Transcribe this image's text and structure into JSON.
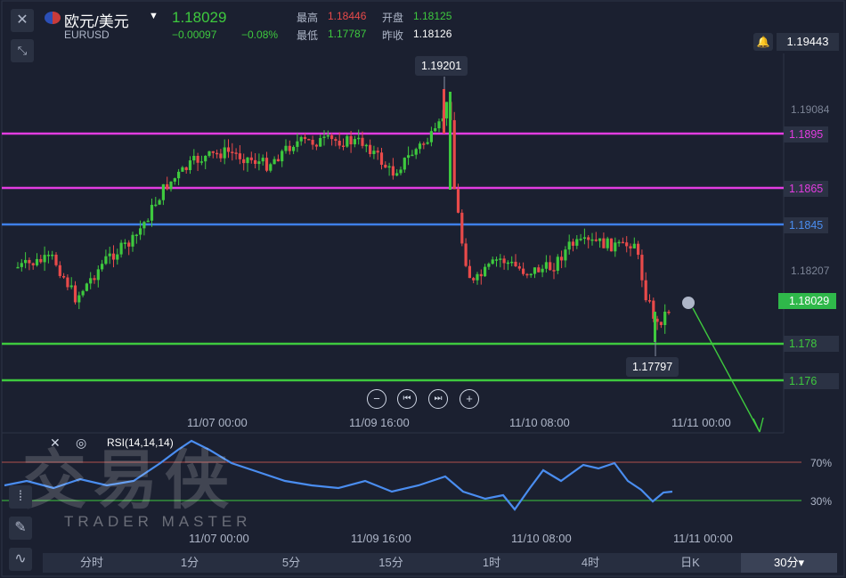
{
  "header": {
    "symbol": "欧元/美元",
    "symbol_code": "EURUSD",
    "price": "1.18029",
    "change": "−0.00097",
    "change_pct": "−0.08%",
    "high_label": "最高",
    "high": "1.18446",
    "open_label": "开盘",
    "open": "1.18125",
    "low_label": "最低",
    "low": "1.17787",
    "prev_label": "昨收",
    "prev": "1.18126",
    "alert_price": "1.19443"
  },
  "price_axis": {
    "labels": [
      "1.19084",
      "1.18207"
    ],
    "current": "1.18029"
  },
  "lines": [
    {
      "label": "1.1895",
      "color": "#e23ce0"
    },
    {
      "label": "1.1865",
      "color": "#e23ce0"
    },
    {
      "label": "1.1845",
      "color": "#3f7fe8"
    },
    {
      "label": "1.178",
      "color": "#3ec93e"
    },
    {
      "label": "1.176",
      "color": "#3ec93e"
    }
  ],
  "tooltips": {
    "high": "1.19201",
    "low": "1.17797"
  },
  "time_axis": [
    "11/07 00:00",
    "11/09 16:00",
    "11/10 08:00",
    "11/11 00:00"
  ],
  "rsi": {
    "label": "RSI(14,14,14)",
    "levels": [
      "70%",
      "30%"
    ],
    "time_axis": [
      "11/07 00:00",
      "11/09 16:00",
      "11/10 08:00",
      "11/11 00:00"
    ]
  },
  "watermark": {
    "cn": "交易侠",
    "en": "TRADER MASTER"
  },
  "timeframes": [
    "分时",
    "1分",
    "5分",
    "15分",
    "1时",
    "4时",
    "日K",
    "30分▾"
  ],
  "colors": {
    "up": "#3ec93e",
    "down": "#e84a4a",
    "rsi": "#4a8df0"
  }
}
